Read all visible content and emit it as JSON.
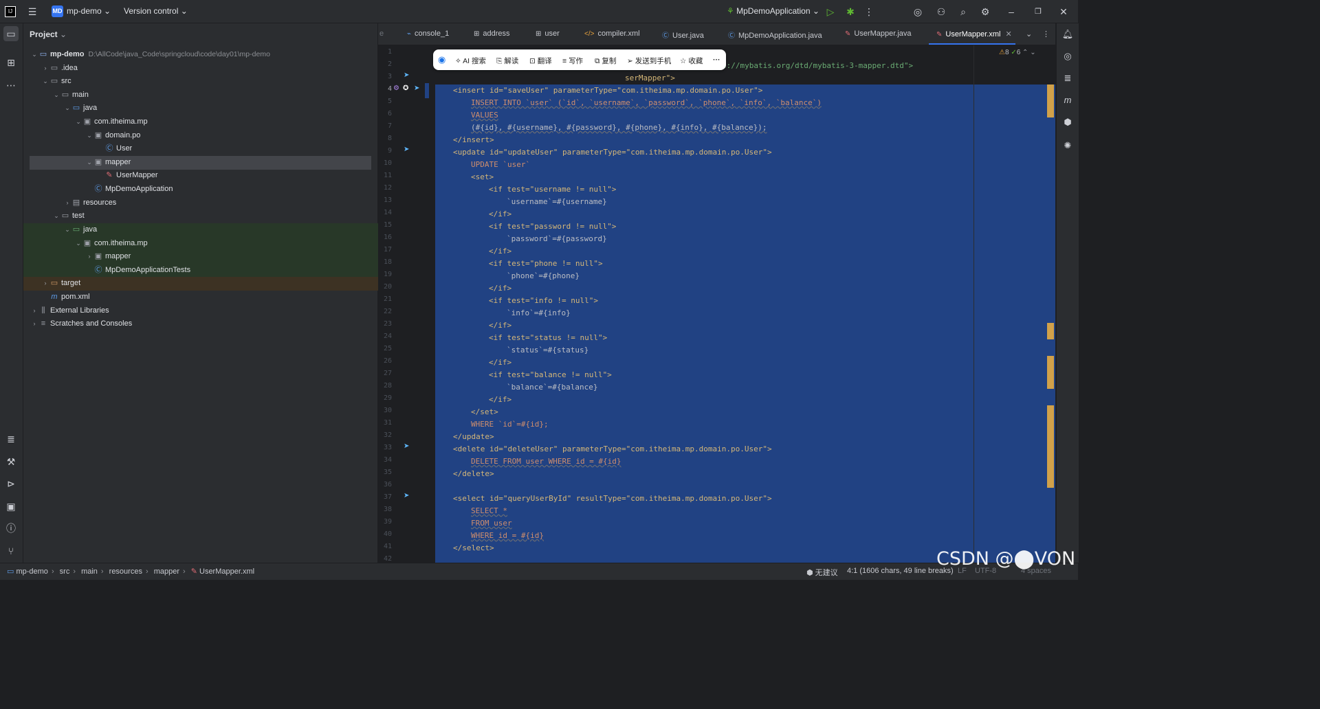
{
  "titlebar": {
    "app_logo": "intellij-logo",
    "menu_icon": "hamburger-icon",
    "project_badge": "MD",
    "project_name": "mp-demo",
    "version_control": "Version control",
    "run_config": "MpDemoApplication"
  },
  "project_panel": {
    "title": "Project",
    "tree": [
      {
        "label": "mp-demo",
        "path": "D:\\AllCode\\java_Code\\springcloud\\code\\day01\\mp-demo",
        "icon": "module-folder-icon"
      },
      {
        "label": ".idea",
        "icon": "folder-icon"
      },
      {
        "label": "src",
        "icon": "folder-icon"
      },
      {
        "label": "main",
        "icon": "folder-icon"
      },
      {
        "label": "java",
        "icon": "source-folder-icon"
      },
      {
        "label": "com.itheima.mp",
        "icon": "package-icon"
      },
      {
        "label": "domain.po",
        "icon": "package-icon"
      },
      {
        "label": "User",
        "icon": "class-icon"
      },
      {
        "label": "mapper",
        "icon": "package-icon"
      },
      {
        "label": "UserMapper",
        "icon": "mybatis-icon"
      },
      {
        "label": "MpDemoApplication",
        "icon": "spring-class-icon"
      },
      {
        "label": "resources",
        "icon": "resources-folder-icon"
      },
      {
        "label": "test",
        "icon": "folder-icon"
      },
      {
        "label": "java",
        "icon": "test-source-folder-icon"
      },
      {
        "label": "com.itheima.mp",
        "icon": "package-icon"
      },
      {
        "label": "mapper",
        "icon": "package-icon"
      },
      {
        "label": "MpDemoApplicationTests",
        "icon": "test-class-icon"
      },
      {
        "label": "target",
        "icon": "excluded-folder-icon"
      },
      {
        "label": "pom.xml",
        "icon": "maven-icon"
      },
      {
        "label": "External Libraries",
        "icon": "libraries-icon"
      },
      {
        "label": "Scratches and Consoles",
        "icon": "scratches-icon"
      }
    ]
  },
  "tabs": [
    {
      "label": "console_1",
      "icon": "console-icon"
    },
    {
      "label": "address",
      "icon": "table-icon"
    },
    {
      "label": "user",
      "icon": "table-icon"
    },
    {
      "label": "compiler.xml",
      "icon": "xml-icon"
    },
    {
      "label": "User.java",
      "icon": "class-icon"
    },
    {
      "label": "MpDemoApplication.java",
      "icon": "spring-class-icon"
    },
    {
      "label": "UserMapper.java",
      "icon": "mybatis-icon"
    },
    {
      "label": "UserMapper.xml",
      "icon": "mybatis-icon",
      "active": true
    }
  ],
  "inspections": {
    "warnings": "8",
    "ok": "6"
  },
  "popup_toolbar": {
    "ai_search": "AI 搜索",
    "explain": "解读",
    "translate": "翻译",
    "write": "写作",
    "copy": "复制",
    "send_phone": "发送到手机",
    "favorite": "收藏",
    "more": "···"
  },
  "line_numbers": [
    "1",
    "2",
    "3",
    "4",
    "5",
    "6",
    "7",
    "8",
    "9",
    "10",
    "11",
    "12",
    "13",
    "14",
    "15",
    "16",
    "17",
    "18",
    "19",
    "20",
    "21",
    "22",
    "23",
    "24",
    "25",
    "26",
    "27",
    "28",
    "29",
    "30",
    "31",
    "32",
    "33",
    "34",
    "35",
    "36",
    "37",
    "38",
    "39",
    "40",
    "41",
    "42"
  ],
  "code": {
    "l2_tail": "p://mybatis.org/dtd/mybatis-3-mapper.dtd\">",
    "l3_tail": "serMapper\">",
    "insert_open": "<insert id=\"saveUser\" parameterType=\"com.itheima.mp.domain.po.User\">",
    "insert_sql1": "INSERT INTO `user` (`id`, `username`, `password`, `phone`, `info`, `balance`)",
    "insert_sql2": "VALUES",
    "insert_sql3": "(#{id}, #{username}, #{password}, #{phone}, #{info}, #{balance});",
    "insert_close": "</insert>",
    "update_open": "<update id=\"updateUser\" parameterType=\"com.itheima.mp.domain.po.User\">",
    "update_sql": "UPDATE `user`",
    "set_open": "<set>",
    "if_username": "<if test=\"username != null\">",
    "set_username": "`username`=#{username}",
    "if_close": "</if>",
    "if_password": "<if test=\"password != null\">",
    "set_password": "`password`=#{password}",
    "if_phone": "<if test=\"phone != null\">",
    "set_phone": "`phone`=#{phone}",
    "if_info": "<if test=\"info != null\">",
    "set_info": "`info`=#{info}",
    "if_status": "<if test=\"status != null\">",
    "set_status": "`status`=#{status}",
    "if_balance": "<if test=\"balance != null\">",
    "set_balance": "`balance`=#{balance}",
    "set_close": "</set>",
    "where_id": "WHERE `id`=#{id};",
    "update_close": "</update>",
    "delete_open": "<delete id=\"deleteUser\" parameterType=\"com.itheima.mp.domain.po.User\">",
    "delete_sql": "DELETE FROM user WHERE id = #{id}",
    "delete_close": "</delete>",
    "select_open": "<select id=\"queryUserById\" resultType=\"com.itheima.mp.domain.po.User\">",
    "select_sql1": "SELECT *",
    "select_sql2": "FROM user",
    "select_sql3": "WHERE id = #{id}",
    "select_close": "</select>"
  },
  "statusbar": {
    "breadcrumb": [
      "mp-demo",
      "src",
      "main",
      "resources",
      "mapper",
      "UserMapper.xml"
    ],
    "suggestion": "无建议",
    "position": "4:1 (1606 chars, 49 line breaks)",
    "line_sep": "LF",
    "encoding": "UTF-8",
    "indent": "4 spaces"
  },
  "watermark": "CSDN @⬤VON",
  "colors": {
    "accent": "#3574f0",
    "selection": "#214283",
    "warning_marker": "#d1a14a"
  }
}
